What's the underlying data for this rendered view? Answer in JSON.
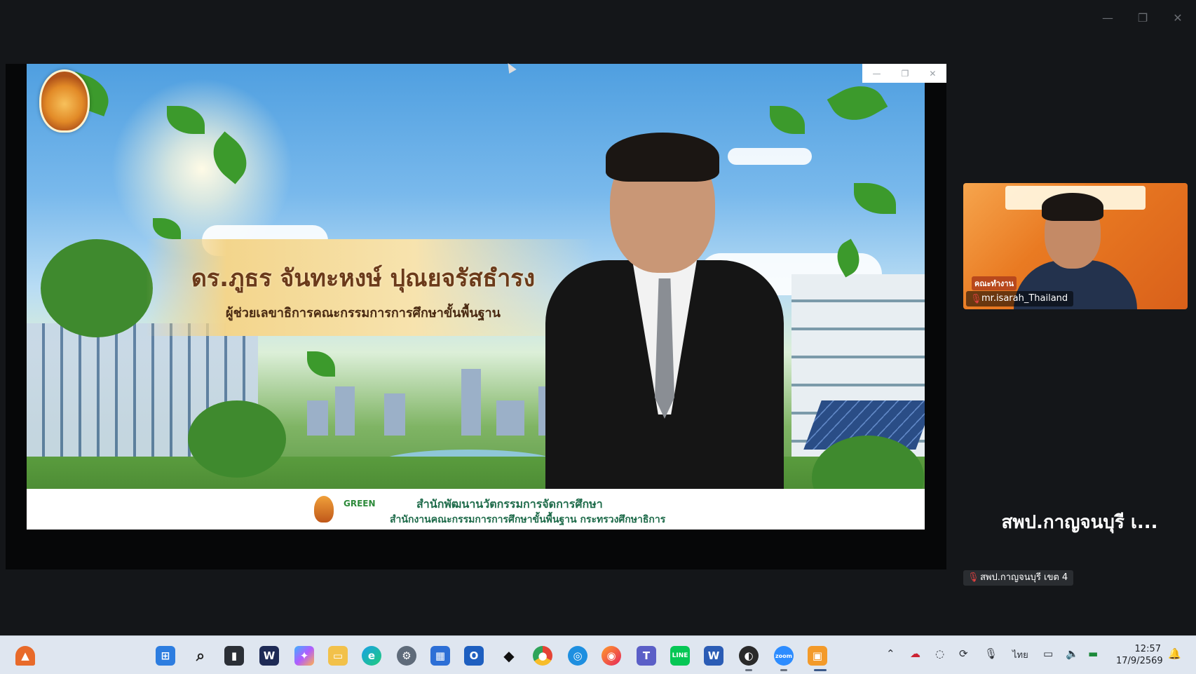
{
  "window": {
    "minimize_icon": "minimize-icon",
    "restore_icon": "restore-icon",
    "close_icon": "close-icon"
  },
  "slide": {
    "name": "ดร.ภูธร จันทะหงษ์ ปุณยจรัสธำรง",
    "position": "ผู้ช่วยเลขาธิการคณะกรรมการการศึกษาขั้นพื้นฐาน",
    "footer_line1": "สำนักพัฒนานวัตกรรมการจัดการศึกษา",
    "footer_line2": "สำนักงานคณะกรรมการการศึกษาขั้นพื้นฐาน กระทรวงศึกษาธิการ",
    "footer_logo_text": "GREEN"
  },
  "participants": {
    "tile_name": "mr.isarah_Thailand",
    "tile_slide_label": "คณะทำงาน",
    "second_name_large": "สพป.กาญจนบุรี เ...",
    "second_label": "สพป.กาญจนบุรี เขต 4"
  },
  "taskbar": {
    "apps": [
      "start-icon",
      "search-icon",
      "task-view-icon",
      "webex-icon",
      "copilot-icon",
      "file-explorer-icon",
      "edge-icon",
      "settings-icon",
      "store-icon",
      "outlook-icon",
      "dropbox-icon",
      "chrome-icon",
      "safari-icon",
      "firefox-icon",
      "teams-icon",
      "line-icon",
      "word-icon",
      "obs-icon",
      "zoom-icon",
      "photo-app-icon"
    ],
    "line_label": "LINE",
    "zoom_label": "zoom",
    "language": "ไทย",
    "time": "12:57",
    "date": "17/9/2569"
  },
  "colors": {
    "background": "#141619",
    "taskbar": "#dfe6f0",
    "slide_text": "#6b3a1a",
    "footer_text": "#1e6b4a"
  }
}
